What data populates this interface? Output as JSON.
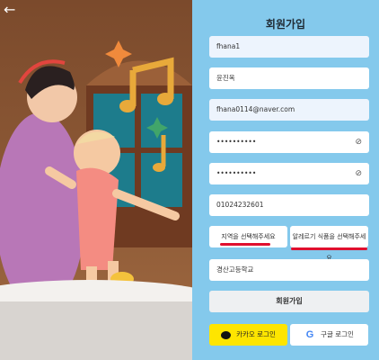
{
  "header": {
    "back_icon": "←"
  },
  "form": {
    "title": "회원가입",
    "id_value": "fhana1",
    "name_value": "윤진옥",
    "email_value": "fhana0114@naver.com",
    "password_value": "••••••••••",
    "password_confirm_value": "••••••••••",
    "phone_value": "01024232601",
    "region_label": "지역을 선택해주세요",
    "allergy_label": "알레르기 식품을 선택해주세요",
    "school_value": "경산고등학교",
    "join_label": "회원가입",
    "kakao_label": "카카오 로그인",
    "google_label": "구글 로그인",
    "google_glyph": "G"
  },
  "colors": {
    "panel": "#84c9ec",
    "kakao": "#fee500",
    "accent_underline": "#e0102f"
  }
}
